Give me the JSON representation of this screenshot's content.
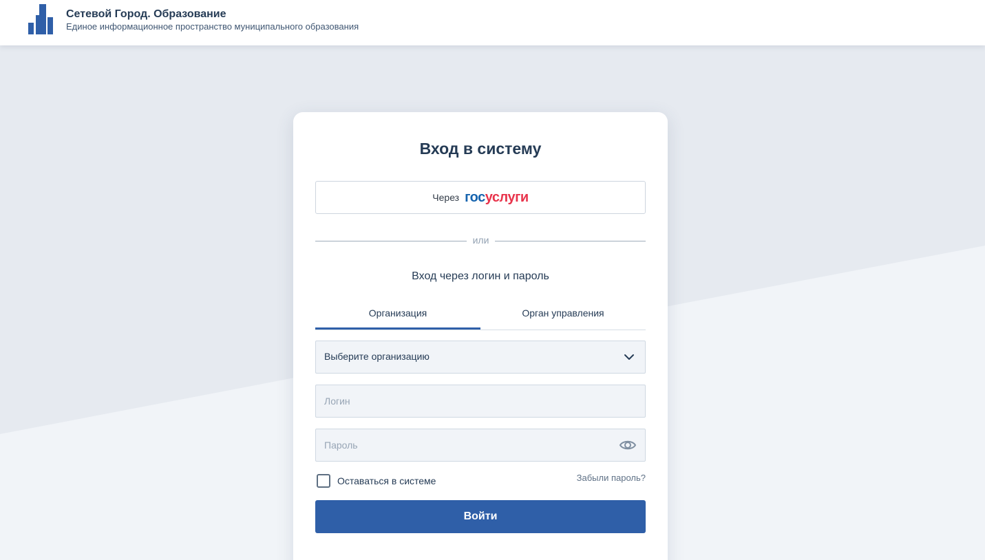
{
  "header": {
    "title": "Сетевой Город. Образование",
    "subtitle": "Единое информационное пространство муниципального образования",
    "logo_icon": "city-buildings-icon",
    "logo_color": "#2f5fa8"
  },
  "login_card": {
    "title": "Вход в систему",
    "gosuslugi": {
      "prefix": "Через",
      "logo_part1": "гос",
      "logo_part2": "услуги",
      "logo_blue": "#1563ae",
      "logo_red": "#e8344c"
    },
    "divider_text": "или",
    "subtitle": "Вход через логин и пароль",
    "tabs": [
      {
        "label": "Организация",
        "active": true
      },
      {
        "label": "Орган управления",
        "active": false
      }
    ],
    "organization_select": {
      "value": "Выберите организацию",
      "icon": "chevron-down-icon"
    },
    "login_field": {
      "value": "",
      "placeholder": "Логин"
    },
    "password_field": {
      "value": "",
      "placeholder": "Пароль",
      "icon": "eye-icon"
    },
    "remember_me": {
      "label": "Оставаться в системе",
      "checked": false
    },
    "forgot_password": "Забыли пароль?",
    "submit_label": "Войти",
    "accent_color": "#2f5fa8"
  }
}
